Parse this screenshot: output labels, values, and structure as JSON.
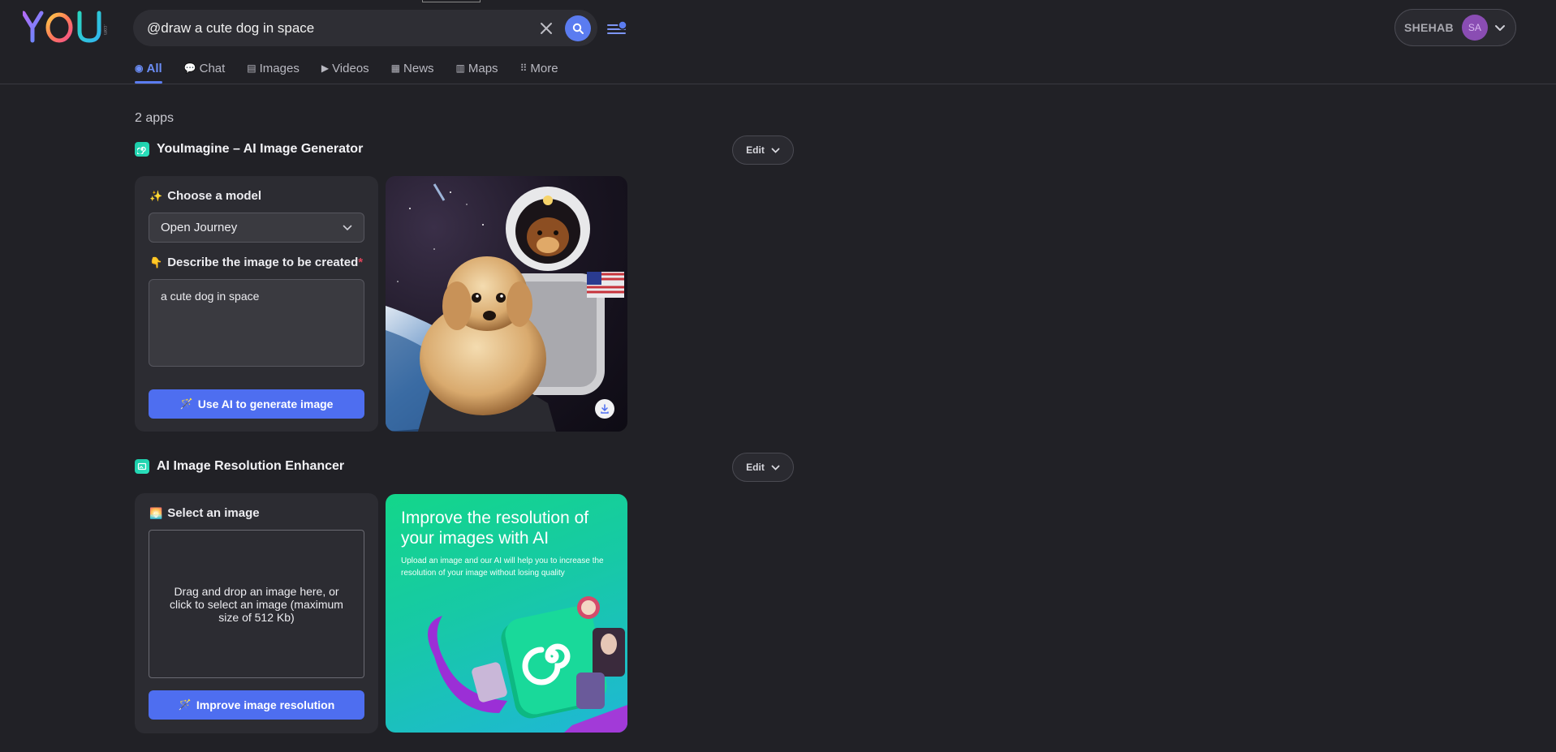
{
  "header": {
    "logo_text": "YOU",
    "logo_suffix": ".com",
    "search": {
      "value": "@draw a cute dog in space",
      "placeholder": ""
    },
    "icons": {
      "clear": "close-icon",
      "search": "search-icon",
      "filter": "sliders-icon"
    },
    "user": {
      "name": "SHEHAB",
      "initials": "SA"
    }
  },
  "nav": {
    "tabs": [
      {
        "label": "All",
        "icon": "compass-icon",
        "glyph": "◉",
        "active": true
      },
      {
        "label": "Chat",
        "icon": "chat-icon",
        "glyph": "💬"
      },
      {
        "label": "Images",
        "icon": "images-icon",
        "glyph": "▤"
      },
      {
        "label": "Videos",
        "icon": "play-icon",
        "glyph": "▶"
      },
      {
        "label": "News",
        "icon": "news-icon",
        "glyph": "▦"
      },
      {
        "label": "Maps",
        "icon": "map-icon",
        "glyph": "▥"
      },
      {
        "label": "More",
        "icon": "grid-dots-icon",
        "glyph": "⠿"
      }
    ]
  },
  "results": {
    "count_label": "2 apps",
    "apps": [
      {
        "title": "YouImagine – AI Image Generator",
        "edit_label": "Edit",
        "model_label": "Choose a model",
        "model_value": "Open Journey",
        "describe_label": "Describe the image to be created",
        "required_mark": "*",
        "prompt_value": "a cute dog in space",
        "button_label": "Use AI to generate image"
      },
      {
        "title": "AI Image Resolution Enhancer",
        "edit_label": "Edit",
        "select_label": "Select an image",
        "dropzone_text": "Drag and drop an image here, or click to select an image (maximum size of 512 Kb)",
        "button_label": "Improve image resolution",
        "promo_title": "Improve the resolution of your images with AI",
        "promo_subtitle": "Upload an image and our AI will help you to increase the resolution of your image without losing quality"
      }
    ]
  },
  "colors": {
    "background": "#212126",
    "accent": "#4e6ef0",
    "panel": "#2c2c32",
    "app_icon": "#19c9a6"
  }
}
